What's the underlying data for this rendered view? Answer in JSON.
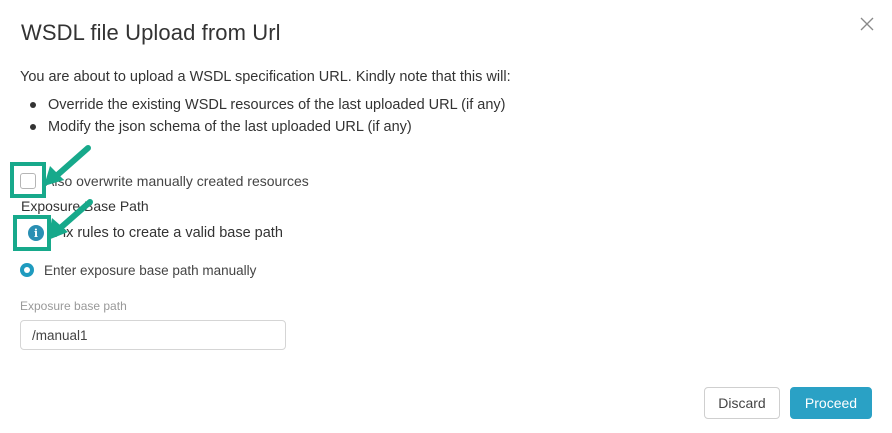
{
  "dialog": {
    "title": "WSDL file Upload from Url",
    "intro": "You are about to upload a WSDL specification URL. Kindly note that this will:",
    "bullets": [
      "Override the existing WSDL resources of the last uploaded URL (if any)",
      "Modify the json schema of the last uploaded URL (if any)"
    ],
    "checkbox_label": "Also overwrite manually created resources",
    "checkbox_checked": false,
    "section_label": "Exposure Base Path",
    "info_text": "Fix rules to create a valid base path",
    "radio_label": "Enter exposure base path manually",
    "radio_selected": true,
    "field_label": "Exposure base path",
    "field_value": "/manual1",
    "discard_label": "Discard",
    "proceed_label": "Proceed"
  },
  "icons": {
    "close": "close-icon",
    "info": "info-icon"
  },
  "colors": {
    "accent": "#2aa1c5",
    "radio": "#1f9bbf",
    "info": "#2a8fb3",
    "annotation": "#17a98b"
  }
}
